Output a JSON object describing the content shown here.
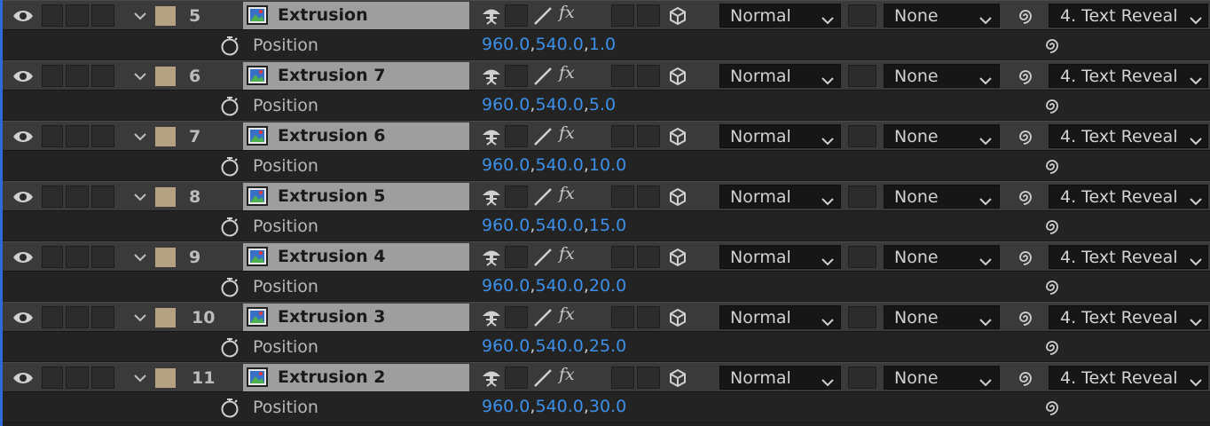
{
  "colors": {
    "accent_value": "#3c90ea",
    "label_color": "#b4a283",
    "selection_edge": "#2f6bd6",
    "name_field_bg": "#9e9e9e"
  },
  "icons": {
    "visibility": "eye-icon",
    "twirl": "chevron-down-icon",
    "layer_type": "image-layer-icon",
    "shy": "puppet-icon",
    "quality": "slash-icon",
    "effects": "fx-icon",
    "three_d": "cube-icon",
    "stopwatch": "stopwatch-icon",
    "parent_pickwhip": "spiral-icon"
  },
  "layers": [
    {
      "number": "5",
      "name": "Extrusion",
      "fx": "fx",
      "mode": "Normal",
      "track_matte": "None",
      "parent": "4. Text Reveal",
      "property": "Position",
      "value": [
        "960.0",
        "540.0",
        "1.0"
      ]
    },
    {
      "number": "6",
      "name": "Extrusion 7",
      "fx": "fx",
      "mode": "Normal",
      "track_matte": "None",
      "parent": "4. Text Reveal",
      "property": "Position",
      "value": [
        "960.0",
        "540.0",
        "5.0"
      ]
    },
    {
      "number": "7",
      "name": "Extrusion 6",
      "fx": "fx",
      "mode": "Normal",
      "track_matte": "None",
      "parent": "4. Text Reveal",
      "property": "Position",
      "value": [
        "960.0",
        "540.0",
        "10.0"
      ]
    },
    {
      "number": "8",
      "name": "Extrusion 5",
      "fx": "fx",
      "mode": "Normal",
      "track_matte": "None",
      "parent": "4. Text Reveal",
      "property": "Position",
      "value": [
        "960.0",
        "540.0",
        "15.0"
      ]
    },
    {
      "number": "9",
      "name": "Extrusion 4",
      "fx": "fx",
      "mode": "Normal",
      "track_matte": "None",
      "parent": "4. Text Reveal",
      "property": "Position",
      "value": [
        "960.0",
        "540.0",
        "20.0"
      ]
    },
    {
      "number": "10",
      "name": "Extrusion 3",
      "fx": "fx",
      "mode": "Normal",
      "track_matte": "None",
      "parent": "4. Text Reveal",
      "property": "Position",
      "value": [
        "960.0",
        "540.0",
        "25.0"
      ]
    },
    {
      "number": "11",
      "name": "Extrusion 2",
      "fx": "fx",
      "mode": "Normal",
      "track_matte": "None",
      "parent": "4. Text Reveal",
      "property": "Position",
      "value": [
        "960.0",
        "540.0",
        "30.0"
      ]
    }
  ]
}
